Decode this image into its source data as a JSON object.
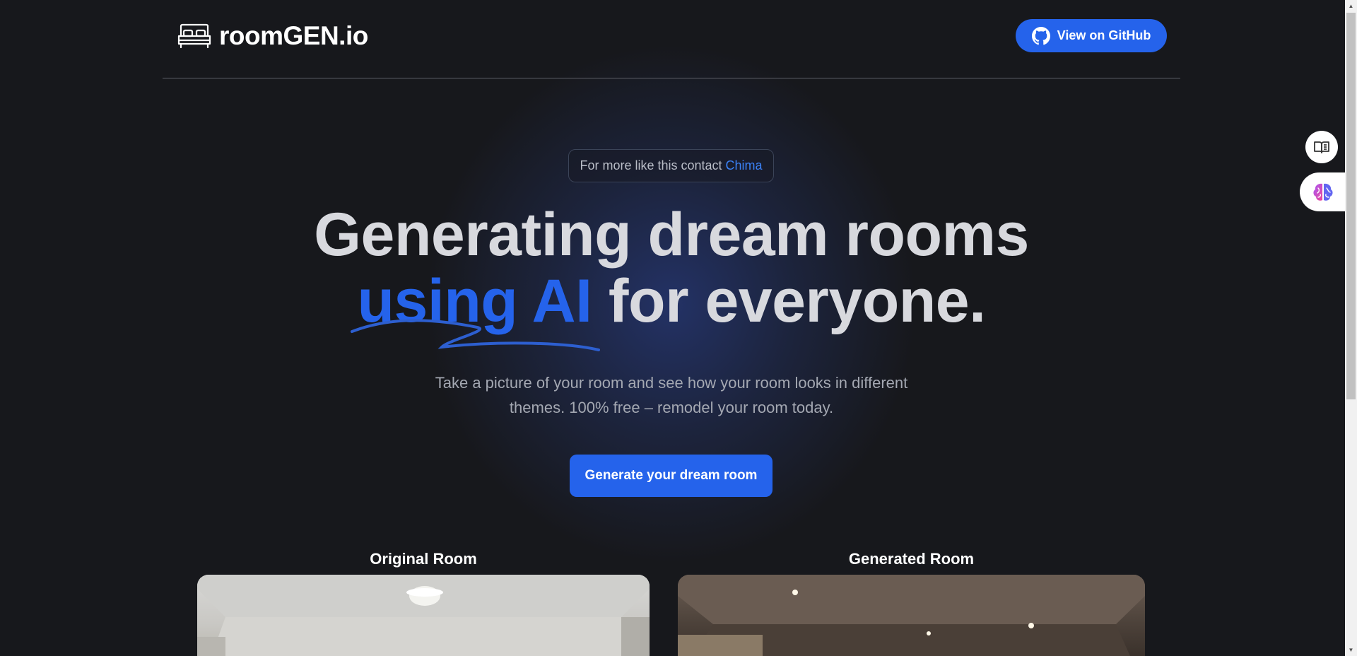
{
  "header": {
    "logo_text": "roomGEN.io",
    "logo_icon": "bed-icon",
    "github_label": "View on GitHub",
    "github_icon": "github-icon"
  },
  "hero": {
    "contact_prefix": "For more like this contact",
    "contact_link": "Chima",
    "headline_line1": "Generating dream rooms",
    "headline_accent": "using AI",
    "headline_rest": "for everyone.",
    "subtitle_line1": "Take a picture of your room and see how your room looks in different",
    "subtitle_line2": "themes. 100% free – remodel your room today.",
    "cta_label": "Generate your dream room"
  },
  "rooms": {
    "original_label": "Original Room",
    "generated_label": "Generated Room"
  },
  "side_widgets": {
    "reader_icon": "book-icon",
    "ai_icon": "brain-icon"
  },
  "colors": {
    "background": "#17181c",
    "accent": "#2563eb",
    "headline": "#d8d9de",
    "subtitle": "#a4a8b2"
  }
}
